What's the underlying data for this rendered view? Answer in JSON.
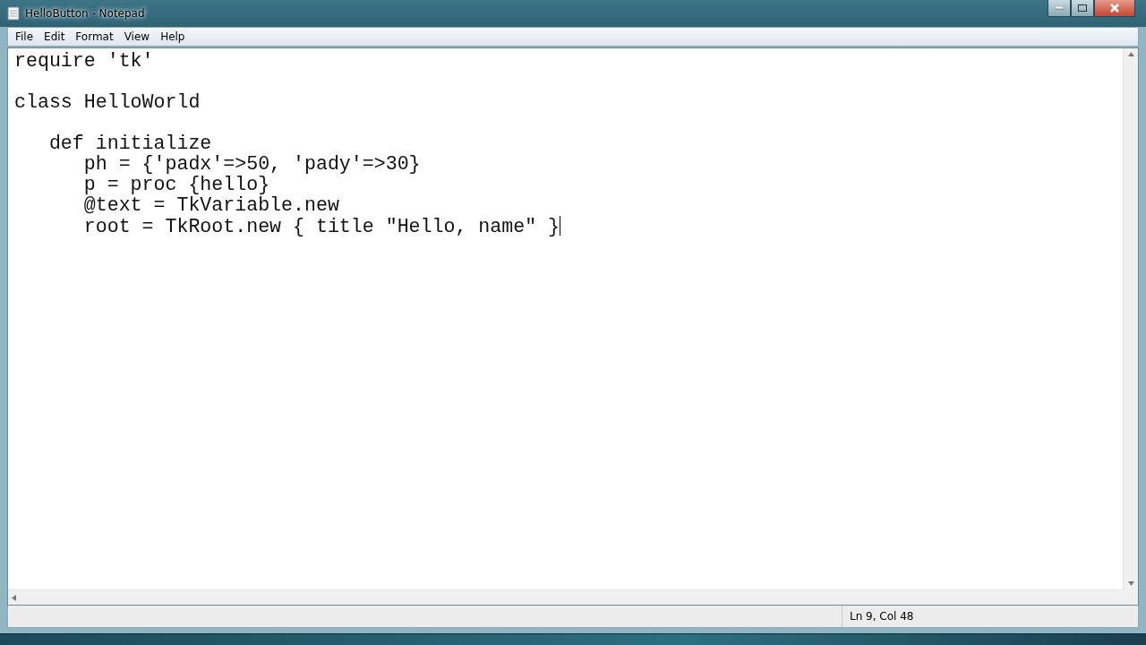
{
  "window": {
    "title": "HelloButton - Notepad"
  },
  "menu": [
    "File",
    "Edit",
    "Format",
    "View",
    "Help"
  ],
  "editor": {
    "text": "require 'tk'\n\nclass HelloWorld\n\n   def initialize\n      ph = {'padx'=>50, 'pady'=>30}\n      p = proc {hello}\n      @text = TkVariable.new\n      root = TkRoot.new { title \"Hello, name\" }"
  },
  "status_bar": {
    "position": "Ln 9, Col 48"
  }
}
